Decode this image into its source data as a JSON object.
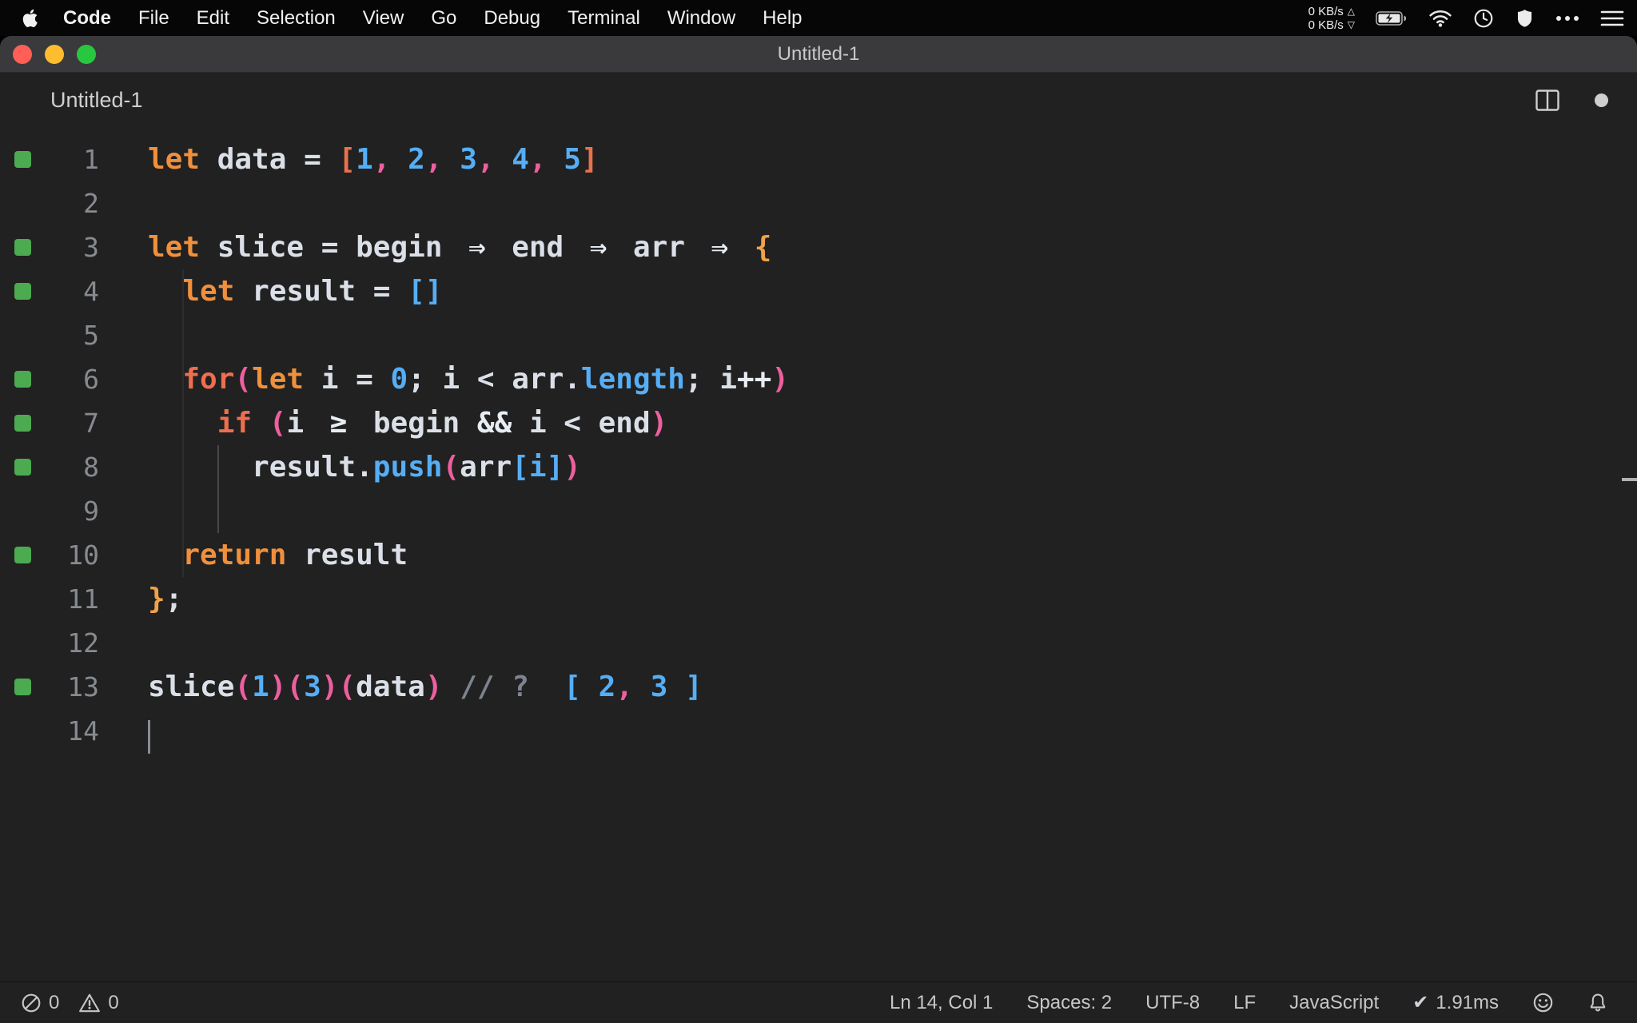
{
  "menu_bar": {
    "items": [
      "Code",
      "File",
      "Edit",
      "Selection",
      "View",
      "Go",
      "Debug",
      "Terminal",
      "Window",
      "Help"
    ],
    "network_up": "0 KB/s",
    "network_down": "0 KB/s"
  },
  "icons": {
    "tri_up": "△",
    "tri_down": "▽",
    "check": "✔"
  },
  "window": {
    "title": "Untitled-1",
    "tab_label": "Untitled-1"
  },
  "editor": {
    "lines": [
      {
        "num": "1",
        "covered": true,
        "segments": [
          {
            "t": "kw",
            "s": "let"
          },
          {
            "t": "plain",
            "s": " data = "
          },
          {
            "t": "brkw",
            "s": "["
          },
          {
            "t": "num",
            "s": "1"
          },
          {
            "t": "comma",
            "s": ", "
          },
          {
            "t": "num",
            "s": "2"
          },
          {
            "t": "comma",
            "s": ", "
          },
          {
            "t": "num",
            "s": "3"
          },
          {
            "t": "comma",
            "s": ", "
          },
          {
            "t": "num",
            "s": "4"
          },
          {
            "t": "comma",
            "s": ", "
          },
          {
            "t": "num",
            "s": "5"
          },
          {
            "t": "brkw",
            "s": "]"
          }
        ]
      },
      {
        "num": "2",
        "covered": false,
        "segments": []
      },
      {
        "num": "3",
        "covered": true,
        "segments": [
          {
            "t": "kw",
            "s": "let"
          },
          {
            "t": "plain",
            "s": " slice = begin "
          },
          {
            "t": "op",
            "s": "⇒",
            "lig": true
          },
          {
            "t": "plain",
            "s": " end "
          },
          {
            "t": "op",
            "s": "⇒",
            "lig": true
          },
          {
            "t": "plain",
            "s": " arr "
          },
          {
            "t": "op",
            "s": "⇒",
            "lig": true
          },
          {
            "t": "plain",
            "s": " "
          },
          {
            "t": "brace",
            "s": "{"
          }
        ]
      },
      {
        "num": "4",
        "covered": true,
        "segments": [
          {
            "t": "plain",
            "s": "  "
          },
          {
            "t": "kw",
            "s": "let"
          },
          {
            "t": "plain",
            "s": " result = "
          },
          {
            "t": "brkb",
            "s": "[]"
          }
        ]
      },
      {
        "num": "5",
        "covered": false,
        "segments": []
      },
      {
        "num": "6",
        "covered": true,
        "segments": [
          {
            "t": "plain",
            "s": "  "
          },
          {
            "t": "ctrl",
            "s": "for"
          },
          {
            "t": "paren",
            "s": "("
          },
          {
            "t": "kw",
            "s": "let"
          },
          {
            "t": "plain",
            "s": " i = "
          },
          {
            "t": "num",
            "s": "0"
          },
          {
            "t": "plain",
            "s": "; i < arr."
          },
          {
            "t": "meth",
            "s": "length"
          },
          {
            "t": "plain",
            "s": "; i"
          },
          {
            "t": "op",
            "s": "++"
          },
          {
            "t": "paren",
            "s": ")"
          }
        ]
      },
      {
        "num": "7",
        "covered": true,
        "segments": [
          {
            "t": "plain",
            "s": "    "
          },
          {
            "t": "ctrl",
            "s": "if"
          },
          {
            "t": "plain",
            "s": " "
          },
          {
            "t": "paren",
            "s": "("
          },
          {
            "t": "plain",
            "s": "i "
          },
          {
            "t": "op",
            "s": "≥",
            "lig": true
          },
          {
            "t": "plain",
            "s": " begin "
          },
          {
            "t": "op",
            "s": "&&"
          },
          {
            "t": "plain",
            "s": " i < end"
          },
          {
            "t": "paren",
            "s": ")"
          }
        ]
      },
      {
        "num": "8",
        "covered": true,
        "segments": [
          {
            "t": "plain",
            "s": "      result."
          },
          {
            "t": "meth",
            "s": "push"
          },
          {
            "t": "paren",
            "s": "("
          },
          {
            "t": "plain",
            "s": "arr"
          },
          {
            "t": "brkb",
            "s": "[i]"
          },
          {
            "t": "paren",
            "s": ")"
          }
        ]
      },
      {
        "num": "9",
        "covered": false,
        "segments": []
      },
      {
        "num": "10",
        "covered": true,
        "segments": [
          {
            "t": "plain",
            "s": "  "
          },
          {
            "t": "kw",
            "s": "return"
          },
          {
            "t": "plain",
            "s": " result"
          }
        ]
      },
      {
        "num": "11",
        "covered": false,
        "segments": [
          {
            "t": "brace",
            "s": "}"
          },
          {
            "t": "plain",
            "s": ";"
          }
        ]
      },
      {
        "num": "12",
        "covered": false,
        "segments": []
      },
      {
        "num": "13",
        "covered": true,
        "segments": [
          {
            "t": "plain",
            "s": "slice"
          },
          {
            "t": "paren",
            "s": "("
          },
          {
            "t": "num",
            "s": "1"
          },
          {
            "t": "paren",
            "s": ")("
          },
          {
            "t": "num",
            "s": "3"
          },
          {
            "t": "paren",
            "s": ")("
          },
          {
            "t": "plain",
            "s": "data"
          },
          {
            "t": "paren",
            "s": ")"
          },
          {
            "t": "plain",
            "s": " "
          },
          {
            "t": "cmt",
            "s": "// ?"
          },
          {
            "t": "plain",
            "s": "  "
          },
          {
            "t": "brkb",
            "s": "[ "
          },
          {
            "t": "num",
            "s": "2"
          },
          {
            "t": "comma",
            "s": ","
          },
          {
            "t": "plain",
            "s": " "
          },
          {
            "t": "num",
            "s": "3"
          },
          {
            "t": "brkb",
            "s": " ]"
          }
        ]
      },
      {
        "num": "14",
        "covered": false,
        "segments": []
      }
    ]
  },
  "status_bar": {
    "errors": "0",
    "warnings": "0",
    "cursor_position": "Ln 14, Col 1",
    "indentation": "Spaces: 2",
    "encoding": "UTF-8",
    "eol": "LF",
    "language": "JavaScript",
    "perf_time": "1.91ms"
  },
  "colors": {
    "keyword": "#f0903c",
    "control": "#ef6e4f",
    "number": "#55aef6",
    "comma": "#ed5f9e",
    "paren": "#ed5f9e",
    "bracket_warm": "#e9724c",
    "bracket_blue": "#55aef6",
    "brace": "#f0a24a",
    "method": "#55aef6",
    "comment": "#7d8490",
    "plain": "#dbe0e8",
    "operator": "#e8edf4",
    "coverage": "#4cab50",
    "line_number": "#878b90",
    "traffic_red": "#ff5f57",
    "traffic_yellow": "#febc2e",
    "traffic_green": "#29c73f"
  }
}
